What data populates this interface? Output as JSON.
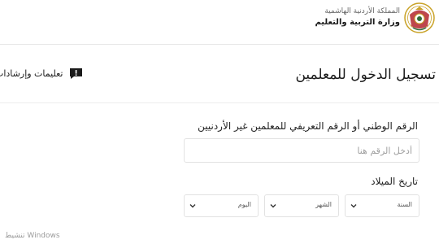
{
  "header": {
    "ministry_top": "المملكة الأردنية الهاشمية",
    "ministry_name": "وزارة التربية والتعليم"
  },
  "title_row": {
    "page_title": "تسجيل الدخول للمعلمين",
    "instructions_label": "تعليمات وإرشادات"
  },
  "form": {
    "id_label": "الرقم الوطني أو الرقم التعريفي للمعلمين غير الأردنيين",
    "id_placeholder": "أدخل الرقم هنا",
    "birthdate_label": "تاريخ الميلاد",
    "year_select": "السنة",
    "month_select": "الشهر",
    "day_select": "اليوم"
  },
  "watermark": {
    "text": "تنشيط Windows"
  },
  "colors": {
    "accent": "#1a1a1a",
    "border": "#e2e2e2",
    "emblem_gold": "#c9a227",
    "emblem_red": "#b3262e"
  },
  "icons": {
    "emblem": "jordan-coat-of-arms-icon",
    "instructions": "exclamation-speech-bubble-icon",
    "dropdown": "chevron-down-icon"
  }
}
